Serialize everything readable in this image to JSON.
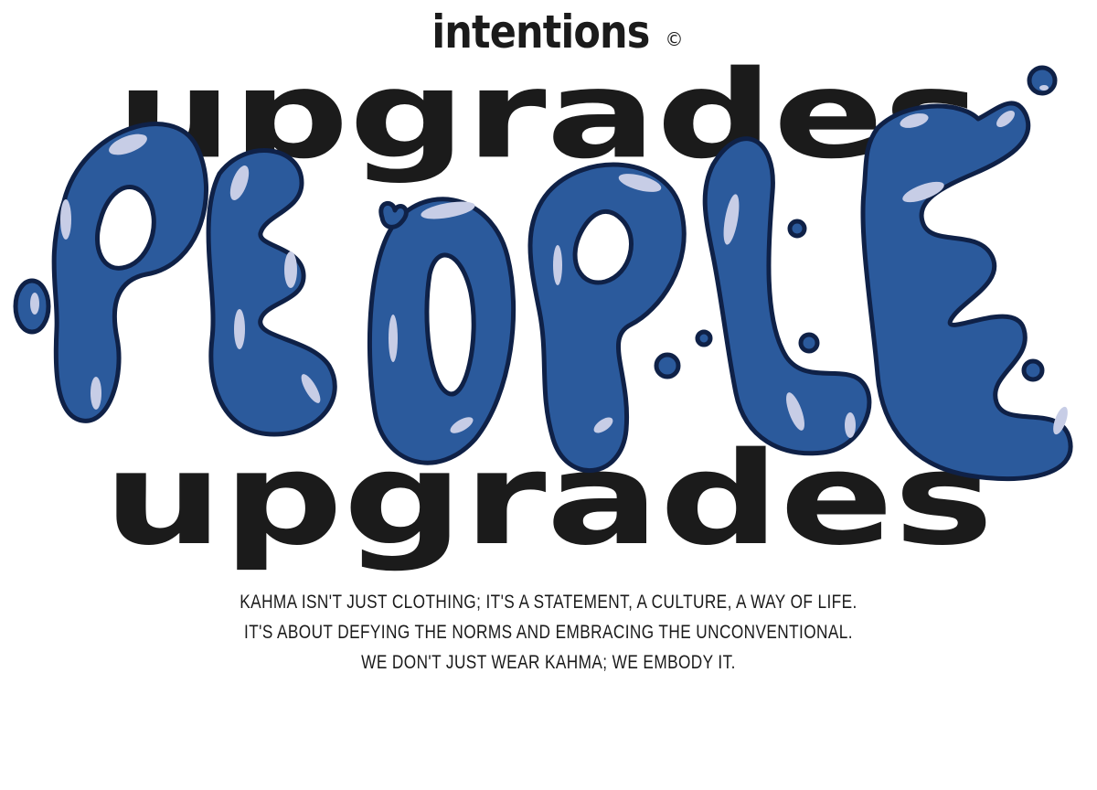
{
  "brand": {
    "name": "intentions",
    "mark": "©"
  },
  "art": {
    "back_word_top": "upgrades",
    "front_word": "PEOPLE",
    "back_word_bottom": "upgrades",
    "colors": {
      "blob_fill": "#2b5a9c",
      "blob_outline": "#0f2147",
      "highlight": "#c7cde6",
      "back_text": "#1b1b1b"
    }
  },
  "tagline": {
    "line1": "KAHMA ISN'T JUST CLOTHING; IT'S A STATEMENT, A CULTURE, A WAY OF LIFE.",
    "line2": "IT'S ABOUT DEFYING THE NORMS AND EMBRACING THE UNCONVENTIONAL.",
    "line3": "WE DON'T JUST WEAR KAHMA; WE EMBODY IT."
  }
}
